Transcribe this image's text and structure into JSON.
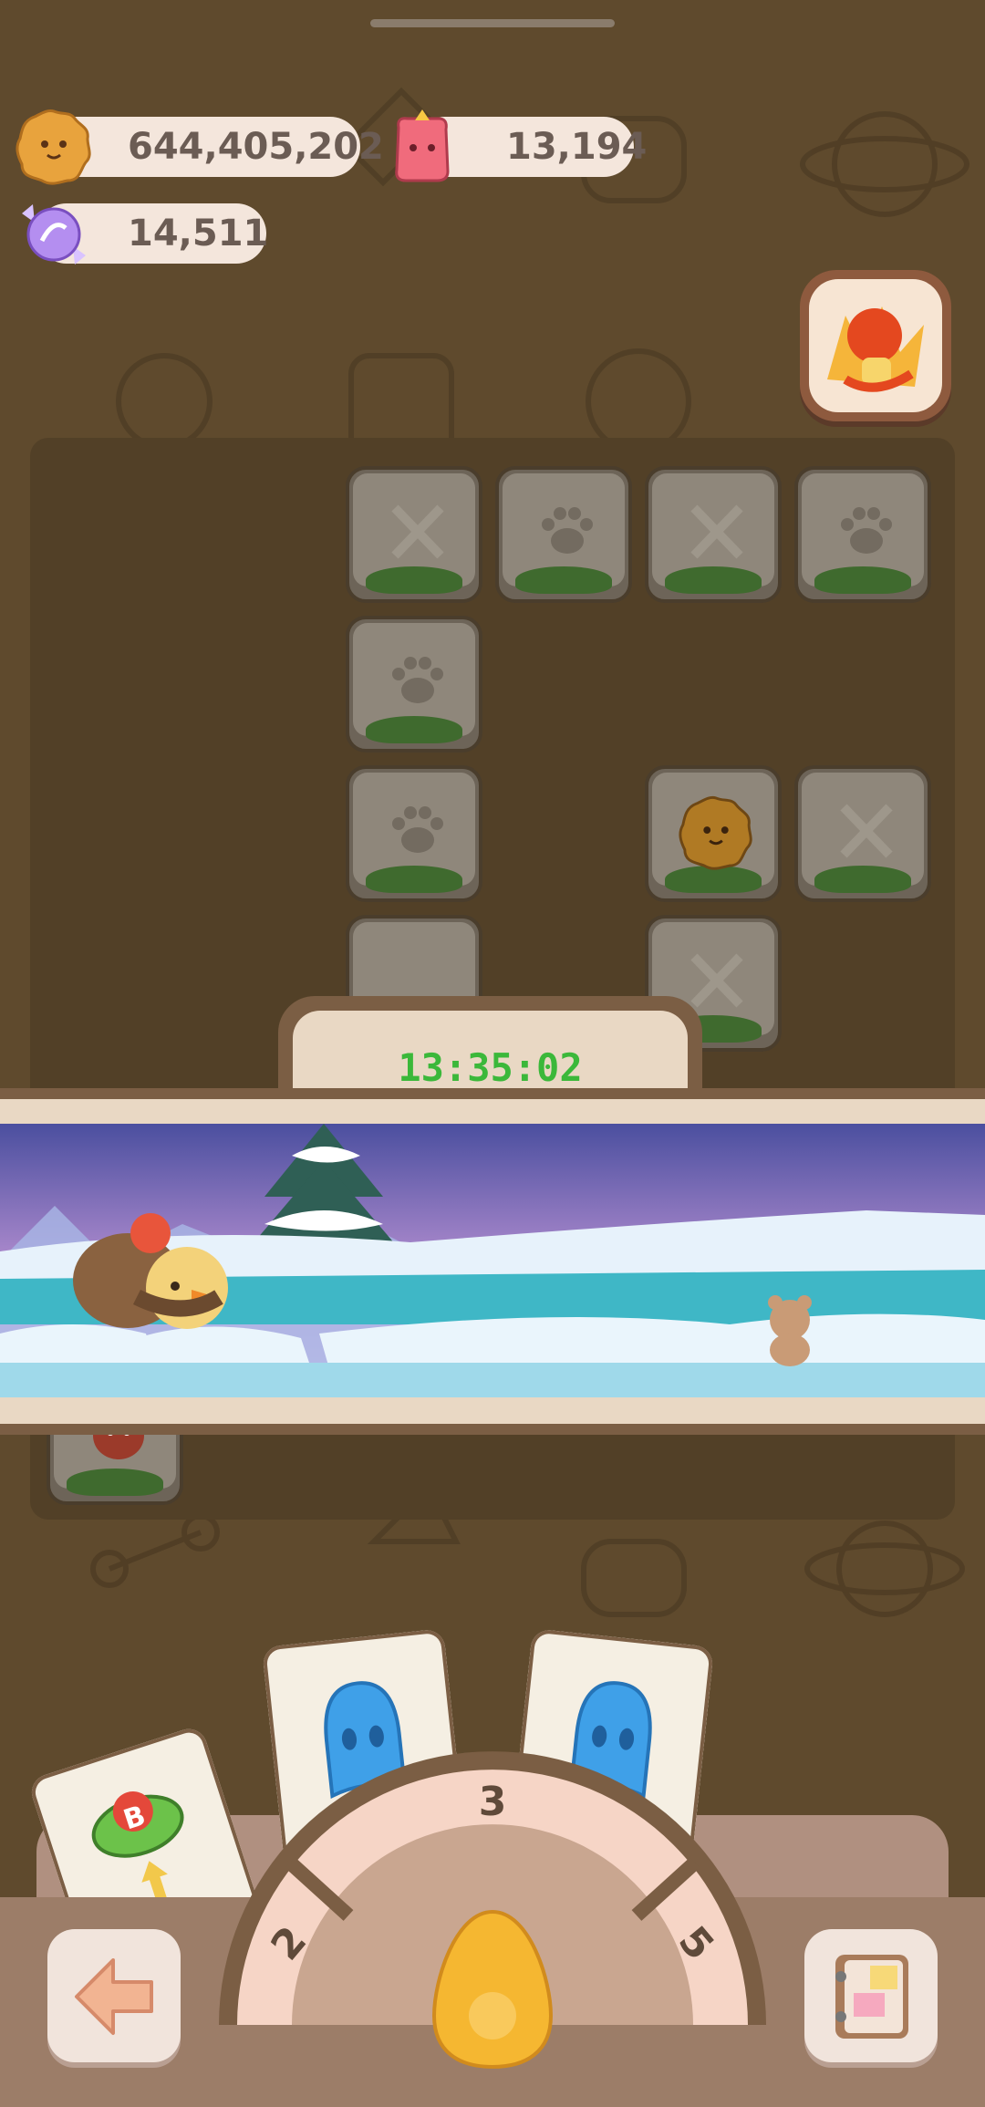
{
  "resources": {
    "cookies": "644,405,202",
    "jelly": "13,194",
    "crystals": "14,511"
  },
  "timer": "13:35:02",
  "dial": {
    "left": "2",
    "top": "3",
    "right": "5"
  },
  "card_badge": "B",
  "icons": {
    "cookie": "cookie-icon",
    "jelly": "jelly-icon",
    "crystal": "crystal-candy-icon",
    "tool": "mushroom-jelly-booster-icon",
    "back": "back-arrow-icon",
    "book": "recipe-book-icon",
    "egg": "egg-icon"
  },
  "colors": {
    "background": "#5f4a2d",
    "timer_text": "#3bb83a",
    "pill_bg": "#f4e6dc"
  }
}
